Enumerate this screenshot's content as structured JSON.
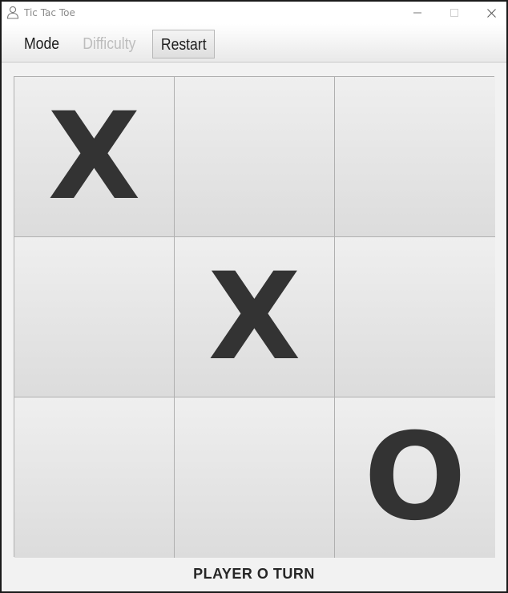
{
  "window": {
    "title": "Tic Tac Toe"
  },
  "toolbar": {
    "mode_label": "Mode",
    "difficulty_label": "Difficulty",
    "restart_label": "Restart"
  },
  "board": {
    "cells": [
      "X",
      "",
      "",
      "",
      "X",
      "",
      "",
      "",
      "O"
    ]
  },
  "status": {
    "text": "PLAYER O TURN"
  },
  "colors": {
    "mark": "#333333",
    "disabled_menu": "#bdbdbd"
  }
}
